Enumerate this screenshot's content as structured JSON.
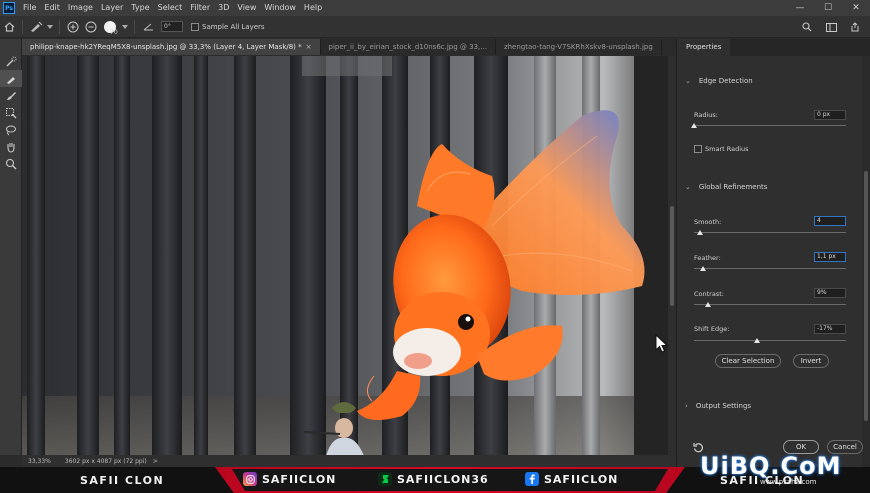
{
  "app": {
    "logo": "Ps"
  },
  "menu": [
    "File",
    "Edit",
    "Image",
    "Layer",
    "Type",
    "Select",
    "Filter",
    "3D",
    "View",
    "Window",
    "Help"
  ],
  "window_controls": {
    "minimize": "—",
    "maximize": "☐",
    "close": "✕"
  },
  "options_bar": {
    "brush_size": "70",
    "angle": "0°",
    "sample_all_layers": "Sample All Layers"
  },
  "tabs": [
    {
      "label": "philipp-knape-hk2YReqM5X8-unsplash.jpg @ 33,3% (Layer 4, Layer Mask/8) *",
      "close": "×"
    },
    {
      "label": "piper_ii_by_eirian_stock_d10ns6c.jpg @ 33,..."
    },
    {
      "label": "zhengtao-tang-V7SKRhXskv8-unsplash.jpg"
    }
  ],
  "status": {
    "zoom": "33,33%",
    "doc_size": "3602 px x 4087 px (72 ppi)",
    "arrow": ">"
  },
  "properties": {
    "tab": "Properties",
    "edge_detection": "Edge Detection",
    "radius_label": "Radius:",
    "radius_value": "0 px",
    "radius_pos": 0.0,
    "smart_radius": "Smart Radius",
    "global_refinements": "Global Refinements",
    "smooth_label": "Smooth:",
    "smooth_value": "4",
    "smooth_pos": 0.04,
    "feather_label": "Feather:",
    "feather_value": "1,1 px",
    "feather_pos": 0.06,
    "contrast_label": "Contrast:",
    "contrast_value": "9%",
    "contrast_pos": 0.09,
    "shift_label": "Shift Edge:",
    "shift_value": "-17%",
    "shift_pos": 0.415,
    "clear_selection": "Clear Selection",
    "invert": "Invert",
    "output_settings": "Output Settings",
    "ok": "OK",
    "cancel": "Cancel"
  },
  "banner": {
    "left_name": "SAFII CLON",
    "instagram": "SAFIICLON",
    "deviantart": "SAFIICLON36",
    "facebook": "SAFIICLON",
    "right_name": "SAFII CLON"
  },
  "watermark": {
    "text": "UiBQ.CoM",
    "sub": "www.psahz.com"
  },
  "colors": {
    "accent_red": "#d40a24",
    "instagram": "#c1358a",
    "deviantart": "#05cc47",
    "facebook": "#1877f2",
    "fish": "#ff6a1a"
  }
}
